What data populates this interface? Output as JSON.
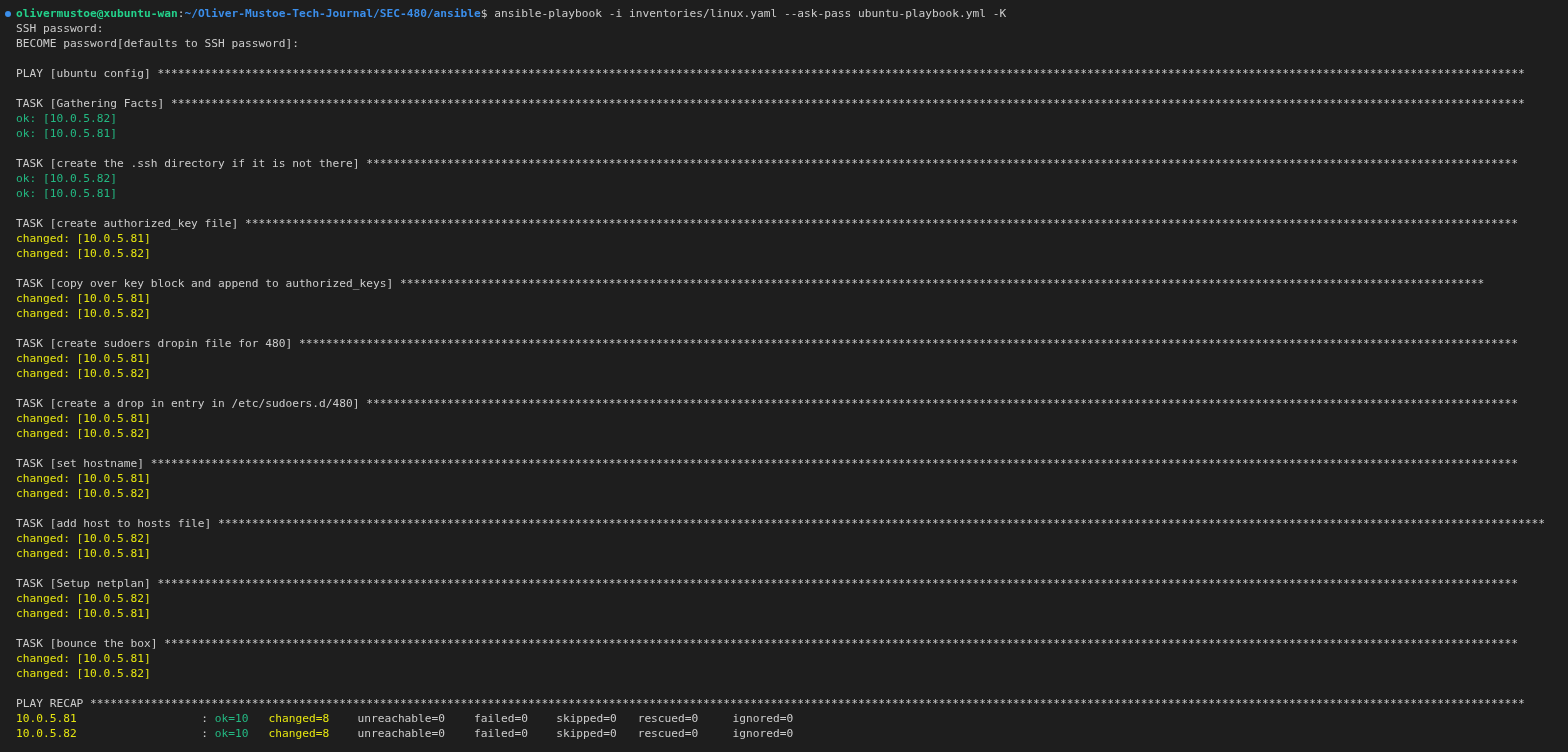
{
  "prompt": {
    "user": "olivermustoe@xubuntu-wan",
    "separator": ":",
    "path": "~/Oliver-Mustoe-Tech-Journal/SEC-480/ansible",
    "symbol": "$",
    "command": "ansible-playbook -i inventories/linux.yaml --ask-pass ubuntu-playbook.yml -K"
  },
  "password_prompts": [
    "SSH password:",
    "BECOME password[defaults to SSH password]:"
  ],
  "play": {
    "title": "PLAY [ubuntu config]",
    "rule": "***********************************************************************************************************************************************************************************************************"
  },
  "tasks": [
    {
      "title": "TASK [Gathering Facts]",
      "rule": "*********************************************************************************************************************************************************************************************************",
      "results": [
        {
          "kind": "ok",
          "text": "ok: [10.0.5.82]"
        },
        {
          "kind": "ok",
          "text": "ok: [10.0.5.81]"
        }
      ]
    },
    {
      "title": "TASK [create the .ssh directory if it is not there]",
      "rule": "***************************************************************************************************************************************************************************",
      "results": [
        {
          "kind": "ok",
          "text": "ok: [10.0.5.82]"
        },
        {
          "kind": "ok",
          "text": "ok: [10.0.5.81]"
        }
      ]
    },
    {
      "title": "TASK [create authorized_key file]",
      "rule": "*********************************************************************************************************************************************************************************************",
      "results": [
        {
          "kind": "changed",
          "text": "changed: [10.0.5.81]"
        },
        {
          "kind": "changed",
          "text": "changed: [10.0.5.82]"
        }
      ]
    },
    {
      "title": "TASK [copy over key block and append to authorized_keys]",
      "rule": "*****************************************************************************************************************************************************************",
      "results": [
        {
          "kind": "changed",
          "text": "changed: [10.0.5.81]"
        },
        {
          "kind": "changed",
          "text": "changed: [10.0.5.82]"
        }
      ]
    },
    {
      "title": "TASK [create sudoers dropin file for 480]",
      "rule": "*************************************************************************************************************************************************************************************",
      "results": [
        {
          "kind": "changed",
          "text": "changed: [10.0.5.81]"
        },
        {
          "kind": "changed",
          "text": "changed: [10.0.5.82]"
        }
      ]
    },
    {
      "title": "TASK [create a drop in entry in /etc/sudoers.d/480]",
      "rule": "***************************************************************************************************************************************************************************",
      "results": [
        {
          "kind": "changed",
          "text": "changed: [10.0.5.81]"
        },
        {
          "kind": "changed",
          "text": "changed: [10.0.5.82]"
        }
      ]
    },
    {
      "title": "TASK [set hostname]",
      "rule": "***********************************************************************************************************************************************************************************************************",
      "results": [
        {
          "kind": "changed",
          "text": "changed: [10.0.5.81]"
        },
        {
          "kind": "changed",
          "text": "changed: [10.0.5.82]"
        }
      ]
    },
    {
      "title": "TASK [add host to hosts file]",
      "rule": "*****************************************************************************************************************************************************************************************************",
      "results": [
        {
          "kind": "changed",
          "text": "changed: [10.0.5.82]"
        },
        {
          "kind": "changed",
          "text": "changed: [10.0.5.81]"
        }
      ]
    },
    {
      "title": "TASK [Setup netplan]",
      "rule": "**********************************************************************************************************************************************************************************************************",
      "results": [
        {
          "kind": "changed",
          "text": "changed: [10.0.5.82]"
        },
        {
          "kind": "changed",
          "text": "changed: [10.0.5.81]"
        }
      ]
    },
    {
      "title": "TASK [bounce the box]",
      "rule": "*********************************************************************************************************************************************************************************************************",
      "results": [
        {
          "kind": "changed",
          "text": "changed: [10.0.5.81]"
        },
        {
          "kind": "changed",
          "text": "changed: [10.0.5.82]"
        }
      ]
    }
  ],
  "recap": {
    "title": "PLAY RECAP",
    "rule": "*********************************************************************************************************************************************************************************************************************",
    "rows": [
      {
        "host": "10.0.5.81",
        "kind": "changed",
        "separator": ":",
        "stats": [
          {
            "kind": "ok",
            "text": "ok=10"
          },
          {
            "kind": "changed",
            "text": "changed=8"
          },
          {
            "kind": "plain",
            "text": "unreachable=0"
          },
          {
            "kind": "plain",
            "text": "failed=0"
          },
          {
            "kind": "plain",
            "text": "skipped=0"
          },
          {
            "kind": "plain",
            "text": "rescued=0"
          },
          {
            "kind": "plain",
            "text": "ignored=0"
          }
        ]
      },
      {
        "host": "10.0.5.82",
        "kind": "changed",
        "separator": ":",
        "stats": [
          {
            "kind": "ok",
            "text": "ok=10"
          },
          {
            "kind": "changed",
            "text": "changed=8"
          },
          {
            "kind": "plain",
            "text": "unreachable=0"
          },
          {
            "kind": "plain",
            "text": "failed=0"
          },
          {
            "kind": "plain",
            "text": "skipped=0"
          },
          {
            "kind": "plain",
            "text": "rescued=0"
          },
          {
            "kind": "plain",
            "text": "ignored=0"
          }
        ]
      }
    ]
  }
}
